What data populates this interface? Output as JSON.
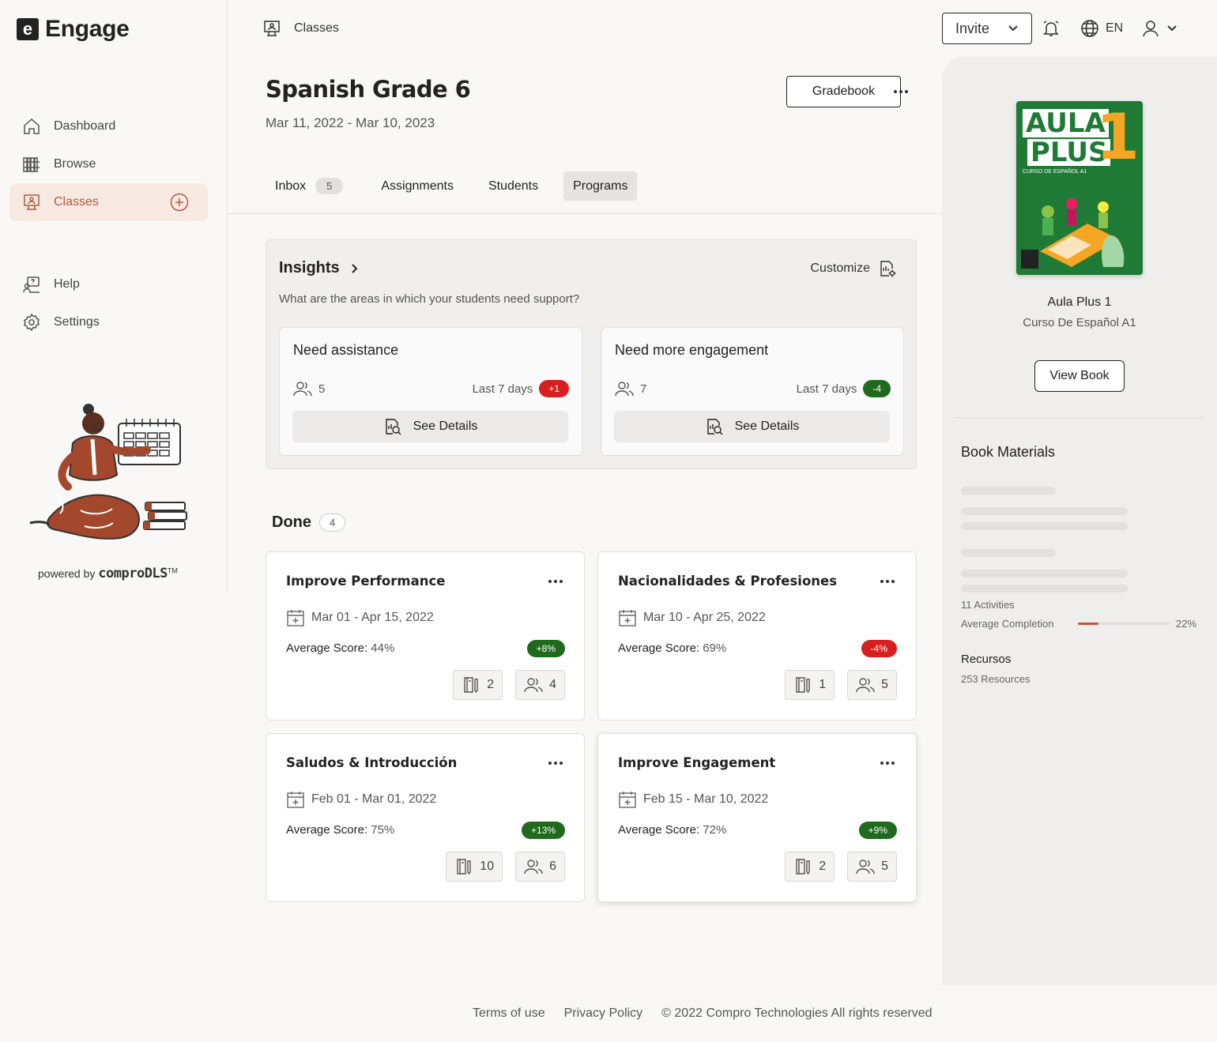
{
  "app": {
    "logo_letter": "e",
    "name": "Engage"
  },
  "sidebar": {
    "items": [
      {
        "label": "Dashboard",
        "icon": "home-icon"
      },
      {
        "label": "Browse",
        "icon": "books-icon"
      },
      {
        "label": "Classes",
        "icon": "classes-icon",
        "active": true
      },
      {
        "label": "Help",
        "icon": "help-icon"
      },
      {
        "label": "Settings",
        "icon": "gear-icon"
      }
    ],
    "powered_by": "powered by",
    "powered_brand": "comproDLS",
    "powered_tm": "TM"
  },
  "topbar": {
    "breadcrumb": "Classes",
    "invite_label": "Invite",
    "language": "EN"
  },
  "header": {
    "title": "Spanish Grade 6",
    "dates": "Mar 11, 2022 - Mar 10, 2023",
    "gradebook_label": "Gradebook"
  },
  "tabs": [
    {
      "label": "Inbox",
      "count": "5"
    },
    {
      "label": "Assignments"
    },
    {
      "label": "Students"
    },
    {
      "label": "Programs",
      "selected": true
    }
  ],
  "insights": {
    "title": "Insights",
    "subtitle": "What are the areas in which your students need support?",
    "customize_label": "Customize",
    "cards": [
      {
        "title": "Need assistance",
        "count": "5",
        "period": "Last 7 days",
        "delta": "+1",
        "delta_color": "#d81f1f",
        "action": "See Details"
      },
      {
        "title": "Need more engagement",
        "count": "7",
        "period": "Last 7 days",
        "delta": "-4",
        "delta_color": "#1f6a1c",
        "action": "See Details"
      }
    ]
  },
  "done": {
    "label": "Done",
    "count": "4",
    "programs": [
      {
        "title": "Improve Performance",
        "dates": "Mar 01 - Apr 15, 2022",
        "avg_label": "Average Score:",
        "avg_value": "44%",
        "delta": "+8%",
        "positive": true,
        "activities": "2",
        "students": "4"
      },
      {
        "title": "Nacionalidades & Profesiones",
        "dates": "Mar 10 - Apr 25, 2022",
        "avg_label": "Average Score:",
        "avg_value": "69%",
        "delta": "-4%",
        "positive": false,
        "activities": "1",
        "students": "5"
      },
      {
        "title": "Saludos & Introducción",
        "dates": "Feb 01 - Mar 01, 2022",
        "avg_label": "Average Score:",
        "avg_value": "75%",
        "delta": "+13%",
        "positive": true,
        "activities": "10",
        "students": "6"
      },
      {
        "title": "Improve Engagement",
        "dates": "Feb 15 - Mar 10, 2022",
        "avg_label": "Average Score:",
        "avg_value": "72%",
        "delta": "+9%",
        "positive": true,
        "activities": "2",
        "students": "5"
      }
    ]
  },
  "book": {
    "cover_line1": "AULA",
    "cover_line2": "PLUS",
    "cover_number": "1",
    "cover_sub": "CURSO DE ESPAÑOL A1",
    "name": "Aula Plus 1",
    "subtitle": "Curso De Español A1",
    "view_label": "View Book",
    "materials_title": "Book Materials",
    "activities": "11 Activities",
    "avg_completion_label": "Average Completion",
    "avg_completion_value": "22%",
    "avg_completion_fraction": 0.22,
    "resources_title": "Recursos",
    "resources_count": "253 Resources"
  },
  "footer": {
    "terms": "Terms of use",
    "privacy": "Privacy Policy",
    "copyright": "© 2022 Compro Technologies All rights reserved"
  },
  "colors": {
    "accent": "#b55a3b",
    "active_bg": "#f8e9e3",
    "positive": "#1f6a1c",
    "negative": "#d81f1f"
  }
}
